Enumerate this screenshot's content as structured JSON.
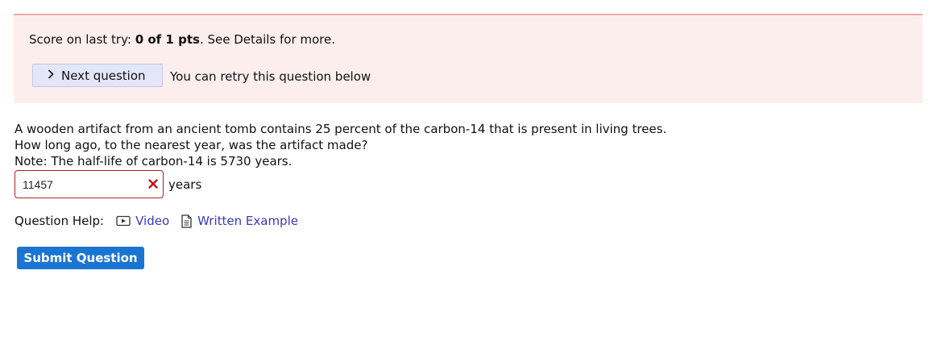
{
  "score_box": {
    "prefix": "Score on last try: ",
    "score": "0 of 1 pts",
    "suffix": ". See Details for more.",
    "next_label": "Next question",
    "retry_note": "You can retry this question below"
  },
  "question": {
    "lines": [
      "A wooden artifact from an ancient tomb contains 25 percent of the carbon-14 that is present in living trees.",
      "How long ago, to the nearest year, was the artifact made?",
      "Note: The half-life of carbon-14 is 5730 years."
    ]
  },
  "answer": {
    "value": "11457",
    "unit": "years",
    "status": "incorrect",
    "error_color": "#b02020"
  },
  "help": {
    "label": "Question Help:",
    "video_label": "Video",
    "example_label": "Written Example",
    "link_color": "#3a3ab8"
  },
  "submit_label": "Submit Question",
  "colors": {
    "score_bg": "#fdeeee",
    "score_border": "#f2a9a9",
    "next_bg": "#e3e6f8",
    "submit_bg": "#1a75d2"
  }
}
